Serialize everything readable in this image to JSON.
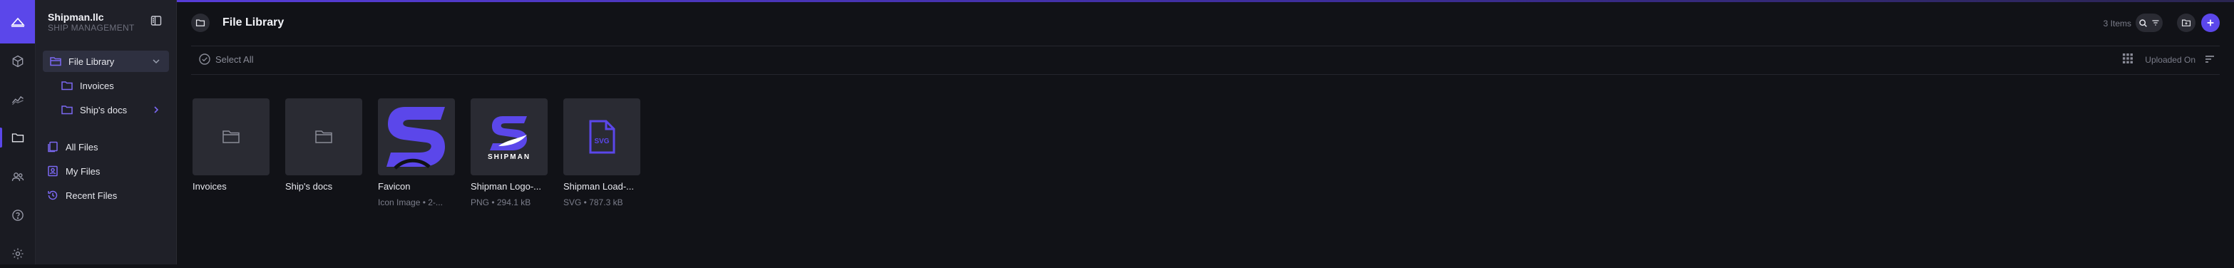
{
  "colors": {
    "accent": "#5b47ea",
    "background": "#111217",
    "sidebar": "#1f2028",
    "rail": "#1a1b22"
  },
  "rail": {
    "logo_icon": "shipman-logo-icon",
    "items": [
      "cube-icon",
      "trend-chart-icon",
      "folder-icon",
      "users-icon",
      "help-icon",
      "settings-icon"
    ],
    "active": "folder-icon"
  },
  "org": {
    "name": "Shipman.llc",
    "subtitle": "SHIP MANAGEMENT"
  },
  "sidebar": {
    "library": {
      "label": "File Library",
      "expanded": true
    },
    "folders": [
      {
        "label": "Invoices"
      },
      {
        "label": "Ship's docs"
      }
    ],
    "quick_links": [
      {
        "label": "All Files"
      },
      {
        "label": "My Files"
      },
      {
        "label": "Recent Files"
      }
    ]
  },
  "header": {
    "title": "File Library",
    "items_count": "3 Items"
  },
  "toolbar": {
    "select_all": "Select All",
    "sort_label": "Uploaded On"
  },
  "files": [
    {
      "name": "Invoices",
      "kind": "folder",
      "meta": ""
    },
    {
      "name": "Ship's docs",
      "kind": "folder",
      "meta": ""
    },
    {
      "name": "Favicon",
      "kind": "image",
      "meta": "Icon Image • 2-..."
    },
    {
      "name": "Shipman Logo-...",
      "kind": "image",
      "meta": "PNG • 294.1 kB",
      "logo_text": "SHIPMAN"
    },
    {
      "name": "Shipman Load-...",
      "kind": "svg",
      "meta": "SVG • 787.3 kB",
      "badge": "SVG"
    }
  ]
}
